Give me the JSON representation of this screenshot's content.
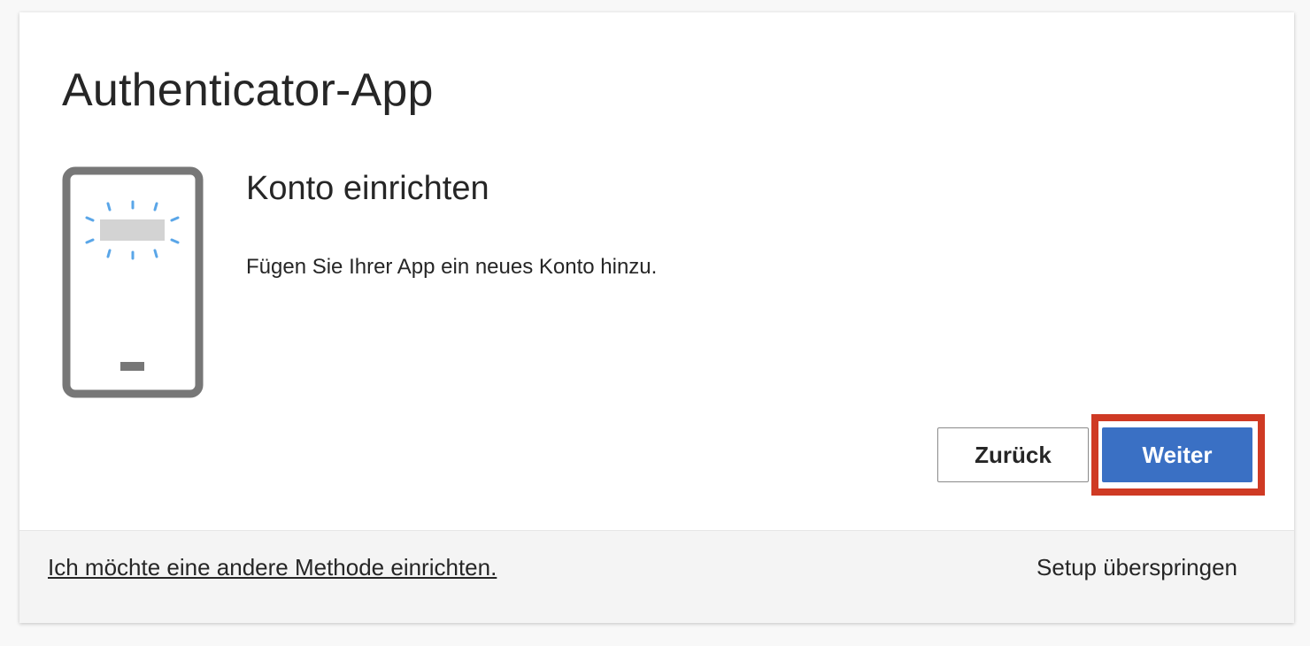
{
  "dialog": {
    "title": "Authenticator-App",
    "subtitle": "Konto einrichten",
    "description": "Fügen Sie Ihrer App ein neues Konto hinzu.",
    "back_label": "Zurück",
    "next_label": "Weiter"
  },
  "footer": {
    "other_method_label": "Ich möchte eine andere Methode einrichten.",
    "skip_label": "Setup überspringen"
  },
  "colors": {
    "primary": "#3a70c4",
    "highlight": "#cf3a24",
    "text": "#262626",
    "phone_frame": "#777777",
    "sparkle": "#5aa6e8"
  },
  "icons": {
    "illustration": "phone-scan-icon"
  }
}
